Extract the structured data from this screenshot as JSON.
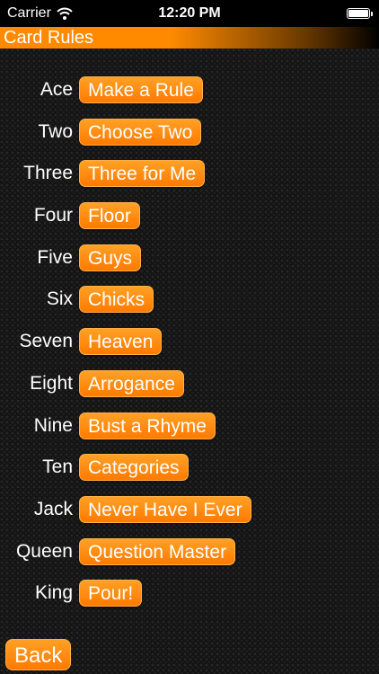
{
  "status_bar": {
    "carrier": "Carrier",
    "time": "12:20 PM",
    "battery_level": 1.0
  },
  "header": {
    "title": "Card Rules"
  },
  "rules": [
    {
      "card": "Ace",
      "rule": "Make a Rule"
    },
    {
      "card": "Two",
      "rule": "Choose Two"
    },
    {
      "card": "Three",
      "rule": "Three for Me"
    },
    {
      "card": "Four",
      "rule": "Floor"
    },
    {
      "card": "Five",
      "rule": "Guys"
    },
    {
      "card": "Six",
      "rule": "Chicks"
    },
    {
      "card": "Seven",
      "rule": "Heaven"
    },
    {
      "card": "Eight",
      "rule": "Arrogance"
    },
    {
      "card": "Nine",
      "rule": "Bust a Rhyme"
    },
    {
      "card": "Ten",
      "rule": "Categories"
    },
    {
      "card": "Jack",
      "rule": "Never Have I Ever"
    },
    {
      "card": "Queen",
      "rule": "Question Master"
    },
    {
      "card": "King",
      "rule": "Pour!"
    }
  ],
  "footer": {
    "back_label": "Back"
  },
  "colors": {
    "accent": "#ff8a00",
    "background": "#141414",
    "text": "#ffffff"
  }
}
